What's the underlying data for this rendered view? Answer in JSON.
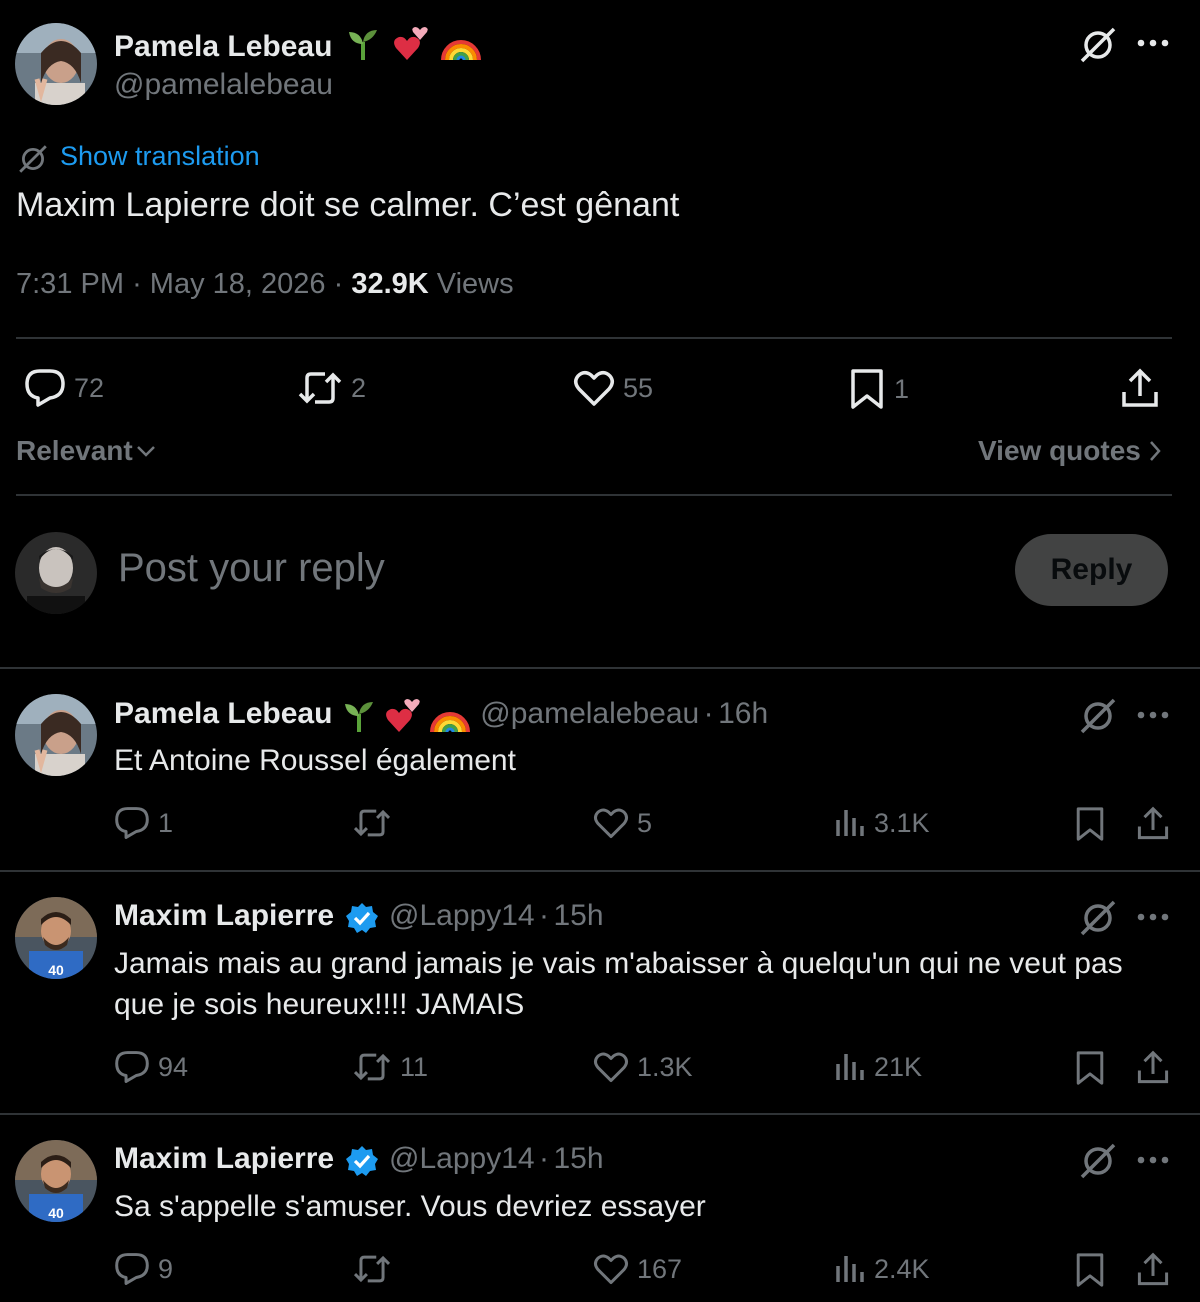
{
  "main_post": {
    "author_name": "Pamela Lebeau",
    "author_handle": "@pamelalebeau",
    "emojis": [
      "seedling-emoji",
      "two-hearts-emoji",
      "rainbow-emoji"
    ],
    "show_translation": "Show translation",
    "text": "Maxim Lapierre doit se calmer. C’est gênant",
    "time": "7:31 PM",
    "date": "May 18, 2026",
    "views_count": "32.9K",
    "views_label": "Views",
    "separator": "·",
    "stats": {
      "replies": "72",
      "reposts": "2",
      "likes": "55",
      "bookmarks": "1"
    },
    "sort_label": "Relevant",
    "view_quotes": "View quotes"
  },
  "composer": {
    "placeholder": "Post your reply",
    "reply_button": "Reply"
  },
  "replies": [
    {
      "author_name": "Pamela Lebeau",
      "author_handle": "@pamelalebeau",
      "time": "16h",
      "verified": false,
      "text": "Et Antoine Roussel également",
      "replies": "1",
      "reposts": "",
      "likes": "5",
      "views": "3.1K"
    },
    {
      "author_name": "Maxim Lapierre",
      "author_handle": "@Lappy14",
      "time": "15h",
      "verified": true,
      "text": "Jamais mais au grand jamais je vais m'abaisser à quelqu'un qui ne veut pas que je sois heureux!!!! JAMAIS",
      "replies": "94",
      "reposts": "11",
      "likes": "1.3K",
      "views": "21K"
    },
    {
      "author_name": "Maxim Lapierre",
      "author_handle": "@Lappy14",
      "time": "15h",
      "verified": true,
      "text": "Sa s'appelle s'amuser. Vous devriez essayer",
      "replies": "9",
      "reposts": "",
      "likes": "167",
      "views": "2.4K"
    }
  ],
  "colors": {
    "background": "#000000",
    "text": "#e7e9ea",
    "muted": "#71767b",
    "link": "#1d9bf0",
    "divider": "#2f3336",
    "verified": "#1d9bf0"
  }
}
